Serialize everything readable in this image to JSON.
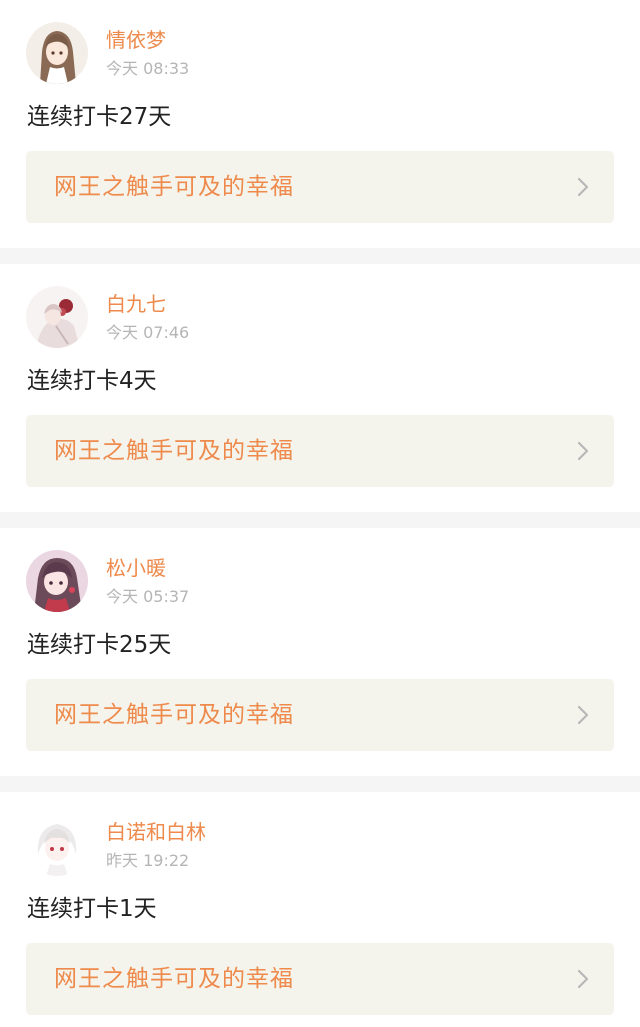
{
  "colors": {
    "accent": "#ee8a4b",
    "timestamp": "#b5b5b5",
    "card_background": "#f4f4ec",
    "separator": "#f5f5f5"
  },
  "posts": [
    {
      "username": "情依梦",
      "time": "今天 08:33",
      "text": "连续打卡27天",
      "topic": "网王之触手可及的幸福",
      "avatar_icon": "anime-girl-avatar-icon"
    },
    {
      "username": "白九七",
      "time": "今天 07:46",
      "text": "连续打卡4天",
      "topic": "网王之触手可及的幸福",
      "avatar_icon": "anime-girl-avatar-icon"
    },
    {
      "username": "松小暖",
      "time": "今天 05:37",
      "text": "连续打卡25天",
      "topic": "网王之触手可及的幸福",
      "avatar_icon": "anime-girl-avatar-icon"
    },
    {
      "username": "白诺和白林",
      "time": "昨天 19:22",
      "text": "连续打卡1天",
      "topic": "网王之触手可及的幸福",
      "avatar_icon": "anime-boy-avatar-icon"
    }
  ]
}
